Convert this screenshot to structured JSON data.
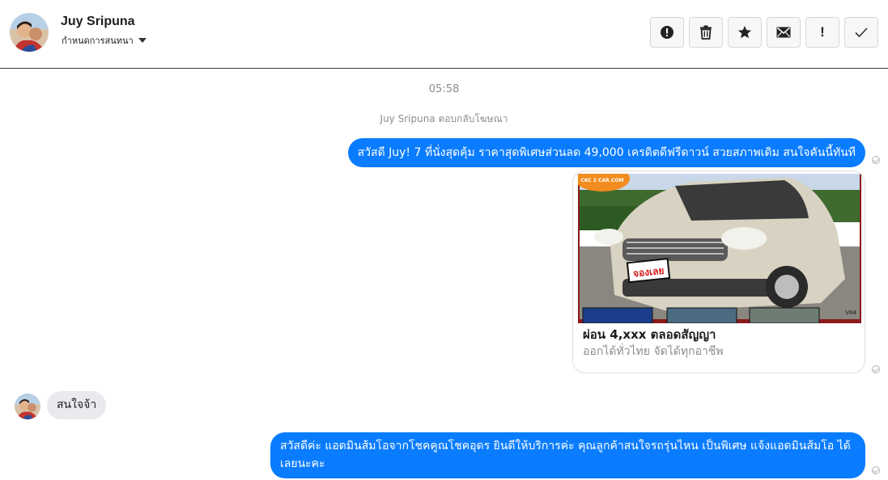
{
  "header": {
    "contact_name": "Juy Sripuna",
    "subtitle": "กำหนดการสนทนา",
    "actions": [
      {
        "name": "report",
        "icon": "exclamation-circle-icon"
      },
      {
        "name": "delete",
        "icon": "trash-icon"
      },
      {
        "name": "star",
        "icon": "star-icon"
      },
      {
        "name": "mark-unread",
        "icon": "envelope-icon"
      },
      {
        "name": "important",
        "icon": "exclamation-icon",
        "glyph": "!"
      },
      {
        "name": "done",
        "icon": "check-icon"
      }
    ]
  },
  "conversation": {
    "timestamp": "05:58",
    "reply_note": "Juy Sripuna ตอบกลับโฆษณา",
    "messages": [
      {
        "direction": "out",
        "text": "สวัสดี Juy! 7 ที่นั่งสุดคุ้ม ราคาสุดพิเศษส่วนลด 49,000 เครดิตดีฟรีดาวน์ สวยสภาพเดิม สนใจคันนี้ทันที"
      },
      {
        "direction": "out",
        "type": "ad-card",
        "image_text": "จองเลย",
        "image_badge": "CKC 2 CAR.COM",
        "image_corner": "V64",
        "title": "ผ่อน 4,xxx ตลอดสัญญา",
        "subtitle": "ออกได้ทั่วไทย จัดได้ทุกอาชีพ"
      },
      {
        "direction": "in",
        "text": "สนใจจ้า"
      },
      {
        "direction": "out",
        "text": "สวัสดีค่ะ แอดมินส้มโอจากโชคคูณโชคอุดร ยินดีให้บริการค่ะ   คุณลูกค้าสนใจรถรุ่นไหน เป็นพิเศษ แจ้งแอดมินส้มโอ ได้เลยนะคะ"
      }
    ]
  },
  "colors": {
    "outgoing_bubble": "#0a7cff",
    "incoming_bubble": "#e9eaed",
    "meta_text": "#8a8d91"
  }
}
